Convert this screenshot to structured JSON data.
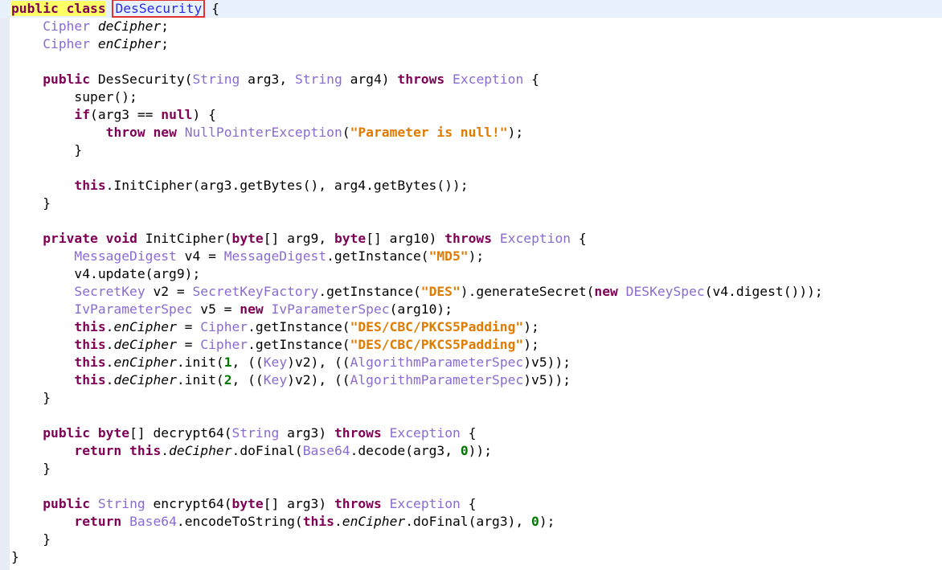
{
  "editor": {
    "lines": [
      [
        {
          "t": "kw-hl",
          "v": "public class"
        },
        {
          "t": "",
          "v": " "
        },
        {
          "t": "cls-hl",
          "v": "DesSecurity"
        },
        {
          "t": "",
          "v": " {"
        }
      ],
      [
        {
          "t": "",
          "v": "    "
        },
        {
          "t": "type",
          "v": "Cipher"
        },
        {
          "t": "",
          "v": " "
        },
        {
          "t": "field",
          "v": "deCipher"
        },
        {
          "t": "",
          "v": ";"
        }
      ],
      [
        {
          "t": "",
          "v": "    "
        },
        {
          "t": "type",
          "v": "Cipher"
        },
        {
          "t": "",
          "v": " "
        },
        {
          "t": "field",
          "v": "enCipher"
        },
        {
          "t": "",
          "v": ";"
        }
      ],
      [],
      [
        {
          "t": "",
          "v": "    "
        },
        {
          "t": "kw",
          "v": "public"
        },
        {
          "t": "",
          "v": " DesSecurity("
        },
        {
          "t": "type",
          "v": "String"
        },
        {
          "t": "",
          "v": " arg3, "
        },
        {
          "t": "type",
          "v": "String"
        },
        {
          "t": "",
          "v": " arg4) "
        },
        {
          "t": "kw",
          "v": "throws"
        },
        {
          "t": "",
          "v": " "
        },
        {
          "t": "type",
          "v": "Exception"
        },
        {
          "t": "",
          "v": " {"
        }
      ],
      [
        {
          "t": "",
          "v": "        super();"
        }
      ],
      [
        {
          "t": "",
          "v": "        "
        },
        {
          "t": "kw",
          "v": "if"
        },
        {
          "t": "",
          "v": "(arg3 == "
        },
        {
          "t": "kw",
          "v": "null"
        },
        {
          "t": "",
          "v": ") {"
        }
      ],
      [
        {
          "t": "",
          "v": "            "
        },
        {
          "t": "kw",
          "v": "throw"
        },
        {
          "t": "",
          "v": " "
        },
        {
          "t": "kw",
          "v": "new"
        },
        {
          "t": "",
          "v": " "
        },
        {
          "t": "type",
          "v": "NullPointerException"
        },
        {
          "t": "",
          "v": "("
        },
        {
          "t": "str",
          "v": "\"Parameter is null!\""
        },
        {
          "t": "",
          "v": ");"
        }
      ],
      [
        {
          "t": "",
          "v": "        }"
        }
      ],
      [],
      [
        {
          "t": "",
          "v": "        "
        },
        {
          "t": "kw",
          "v": "this"
        },
        {
          "t": "",
          "v": ".InitCipher(arg3.getBytes(), arg4.getBytes());"
        }
      ],
      [
        {
          "t": "",
          "v": "    }"
        }
      ],
      [],
      [
        {
          "t": "",
          "v": "    "
        },
        {
          "t": "kw",
          "v": "private"
        },
        {
          "t": "",
          "v": " "
        },
        {
          "t": "kw",
          "v": "void"
        },
        {
          "t": "",
          "v": " InitCipher("
        },
        {
          "t": "kw",
          "v": "byte"
        },
        {
          "t": "",
          "v": "[] arg9, "
        },
        {
          "t": "kw",
          "v": "byte"
        },
        {
          "t": "",
          "v": "[] arg10) "
        },
        {
          "t": "kw",
          "v": "throws"
        },
        {
          "t": "",
          "v": " "
        },
        {
          "t": "type",
          "v": "Exception"
        },
        {
          "t": "",
          "v": " {"
        }
      ],
      [
        {
          "t": "",
          "v": "        "
        },
        {
          "t": "type",
          "v": "MessageDigest"
        },
        {
          "t": "",
          "v": " v4 = "
        },
        {
          "t": "type",
          "v": "MessageDigest"
        },
        {
          "t": "",
          "v": ".getInstance("
        },
        {
          "t": "str",
          "v": "\"MD5\""
        },
        {
          "t": "",
          "v": ");"
        }
      ],
      [
        {
          "t": "",
          "v": "        v4.update(arg9);"
        }
      ],
      [
        {
          "t": "",
          "v": "        "
        },
        {
          "t": "type",
          "v": "SecretKey"
        },
        {
          "t": "",
          "v": " v2 = "
        },
        {
          "t": "type",
          "v": "SecretKeyFactory"
        },
        {
          "t": "",
          "v": ".getInstance("
        },
        {
          "t": "str",
          "v": "\"DES\""
        },
        {
          "t": "",
          "v": ").generateSecret("
        },
        {
          "t": "kw",
          "v": "new"
        },
        {
          "t": "",
          "v": " "
        },
        {
          "t": "type",
          "v": "DESKeySpec"
        },
        {
          "t": "",
          "v": "(v4.digest()));"
        }
      ],
      [
        {
          "t": "",
          "v": "        "
        },
        {
          "t": "type",
          "v": "IvParameterSpec"
        },
        {
          "t": "",
          "v": " v5 = "
        },
        {
          "t": "kw",
          "v": "new"
        },
        {
          "t": "",
          "v": " "
        },
        {
          "t": "type",
          "v": "IvParameterSpec"
        },
        {
          "t": "",
          "v": "(arg10);"
        }
      ],
      [
        {
          "t": "",
          "v": "        "
        },
        {
          "t": "kw",
          "v": "this"
        },
        {
          "t": "",
          "v": "."
        },
        {
          "t": "field",
          "v": "enCipher"
        },
        {
          "t": "",
          "v": " = "
        },
        {
          "t": "type",
          "v": "Cipher"
        },
        {
          "t": "",
          "v": ".getInstance("
        },
        {
          "t": "str",
          "v": "\"DES/CBC/PKCS5Padding\""
        },
        {
          "t": "",
          "v": ");"
        }
      ],
      [
        {
          "t": "",
          "v": "        "
        },
        {
          "t": "kw",
          "v": "this"
        },
        {
          "t": "",
          "v": "."
        },
        {
          "t": "field",
          "v": "deCipher"
        },
        {
          "t": "",
          "v": " = "
        },
        {
          "t": "type",
          "v": "Cipher"
        },
        {
          "t": "",
          "v": ".getInstance("
        },
        {
          "t": "str",
          "v": "\"DES/CBC/PKCS5Padding\""
        },
        {
          "t": "",
          "v": ");"
        }
      ],
      [
        {
          "t": "",
          "v": "        "
        },
        {
          "t": "kw",
          "v": "this"
        },
        {
          "t": "",
          "v": "."
        },
        {
          "t": "field",
          "v": "enCipher"
        },
        {
          "t": "",
          "v": ".init("
        },
        {
          "t": "num",
          "v": "1"
        },
        {
          "t": "",
          "v": ", (("
        },
        {
          "t": "type",
          "v": "Key"
        },
        {
          "t": "",
          "v": ")v2), (("
        },
        {
          "t": "type",
          "v": "AlgorithmParameterSpec"
        },
        {
          "t": "",
          "v": ")v5));"
        }
      ],
      [
        {
          "t": "",
          "v": "        "
        },
        {
          "t": "kw",
          "v": "this"
        },
        {
          "t": "",
          "v": "."
        },
        {
          "t": "field",
          "v": "deCipher"
        },
        {
          "t": "",
          "v": ".init("
        },
        {
          "t": "num",
          "v": "2"
        },
        {
          "t": "",
          "v": ", (("
        },
        {
          "t": "type",
          "v": "Key"
        },
        {
          "t": "",
          "v": ")v2), (("
        },
        {
          "t": "type",
          "v": "AlgorithmParameterSpec"
        },
        {
          "t": "",
          "v": ")v5));"
        }
      ],
      [
        {
          "t": "",
          "v": "    }"
        }
      ],
      [],
      [
        {
          "t": "",
          "v": "    "
        },
        {
          "t": "kw",
          "v": "public"
        },
        {
          "t": "",
          "v": " "
        },
        {
          "t": "kw",
          "v": "byte"
        },
        {
          "t": "",
          "v": "[] decrypt64("
        },
        {
          "t": "type",
          "v": "String"
        },
        {
          "t": "",
          "v": " arg3) "
        },
        {
          "t": "kw",
          "v": "throws"
        },
        {
          "t": "",
          "v": " "
        },
        {
          "t": "type",
          "v": "Exception"
        },
        {
          "t": "",
          "v": " {"
        }
      ],
      [
        {
          "t": "",
          "v": "        "
        },
        {
          "t": "kw",
          "v": "return"
        },
        {
          "t": "",
          "v": " "
        },
        {
          "t": "kw",
          "v": "this"
        },
        {
          "t": "",
          "v": "."
        },
        {
          "t": "field",
          "v": "deCipher"
        },
        {
          "t": "",
          "v": ".doFinal("
        },
        {
          "t": "type",
          "v": "Base64"
        },
        {
          "t": "",
          "v": ".decode(arg3, "
        },
        {
          "t": "num",
          "v": "0"
        },
        {
          "t": "",
          "v": "));"
        }
      ],
      [
        {
          "t": "",
          "v": "    }"
        }
      ],
      [],
      [
        {
          "t": "",
          "v": "    "
        },
        {
          "t": "kw",
          "v": "public"
        },
        {
          "t": "",
          "v": " "
        },
        {
          "t": "type",
          "v": "String"
        },
        {
          "t": "",
          "v": " encrypt64("
        },
        {
          "t": "kw",
          "v": "byte"
        },
        {
          "t": "",
          "v": "[] arg3) "
        },
        {
          "t": "kw",
          "v": "throws"
        },
        {
          "t": "",
          "v": " "
        },
        {
          "t": "type",
          "v": "Exception"
        },
        {
          "t": "",
          "v": " {"
        }
      ],
      [
        {
          "t": "",
          "v": "        "
        },
        {
          "t": "kw",
          "v": "return"
        },
        {
          "t": "",
          "v": " "
        },
        {
          "t": "type",
          "v": "Base64"
        },
        {
          "t": "",
          "v": ".encodeToString("
        },
        {
          "t": "kw",
          "v": "this"
        },
        {
          "t": "",
          "v": "."
        },
        {
          "t": "field",
          "v": "enCipher"
        },
        {
          "t": "",
          "v": ".doFinal(arg3), "
        },
        {
          "t": "num",
          "v": "0"
        },
        {
          "t": "",
          "v": ");"
        }
      ],
      [
        {
          "t": "",
          "v": "    }"
        }
      ],
      [
        {
          "t": "",
          "v": "}"
        }
      ]
    ],
    "colors": {
      "keyword": "#7f0055",
      "type": "#8a6bd1",
      "string": "#e07b00",
      "number": "#007800",
      "class_name": "#2b2be6",
      "selection_box": "#e53030",
      "keyword_highlight": "#ffff66",
      "line_highlight": "#e8f2fe",
      "gutter": "#e8ecf4"
    }
  }
}
